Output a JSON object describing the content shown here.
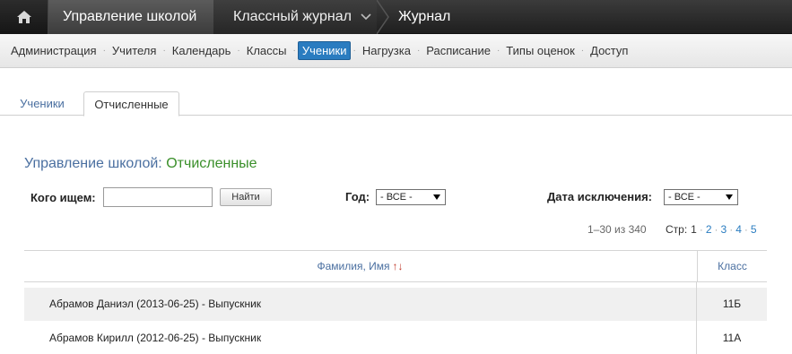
{
  "topbar": {
    "school": "Управление школой",
    "journal": "Классный журнал",
    "current": "Журнал"
  },
  "subnav": {
    "items": [
      "Администрация",
      "Учителя",
      "Календарь",
      "Классы",
      "Ученики",
      "Нагрузка",
      "Расписание",
      "Типы оценок",
      "Доступ"
    ],
    "active": "Ученики",
    "separator": "·"
  },
  "tabs": {
    "students": "Ученики",
    "expelled": "Отчисленные"
  },
  "title": {
    "school": "Управление школой:",
    "current": "Отчисленные"
  },
  "filters": {
    "search_label": "Кого ищем:",
    "search_value": "",
    "find_button": "Найти",
    "year_label": "Год:",
    "year_value": "- ВСЕ -",
    "date_label": "Дата исключения:",
    "date_value": "- ВСЕ -"
  },
  "pagination": {
    "range": "1–30 из 340",
    "label": "Стр:",
    "pages": [
      "1",
      "2",
      "3",
      "4",
      "5"
    ],
    "current": "1"
  },
  "table": {
    "col_name": "Фамилия, Имя",
    "sort_icon": "↑↓",
    "col_class": "Класс",
    "rows": [
      {
        "name": "Абрамов Даниэл (2013-06-25) - Выпускник",
        "class": "11Б"
      },
      {
        "name": "Абрамов Кирилл (2012-06-25) - Выпускник",
        "class": "11А"
      }
    ]
  },
  "colors": {
    "accent": "#2a7cc0",
    "title_green": "#3a8f2a",
    "link_blue": "#4a6fa0",
    "sort_red": "#c0392b"
  }
}
